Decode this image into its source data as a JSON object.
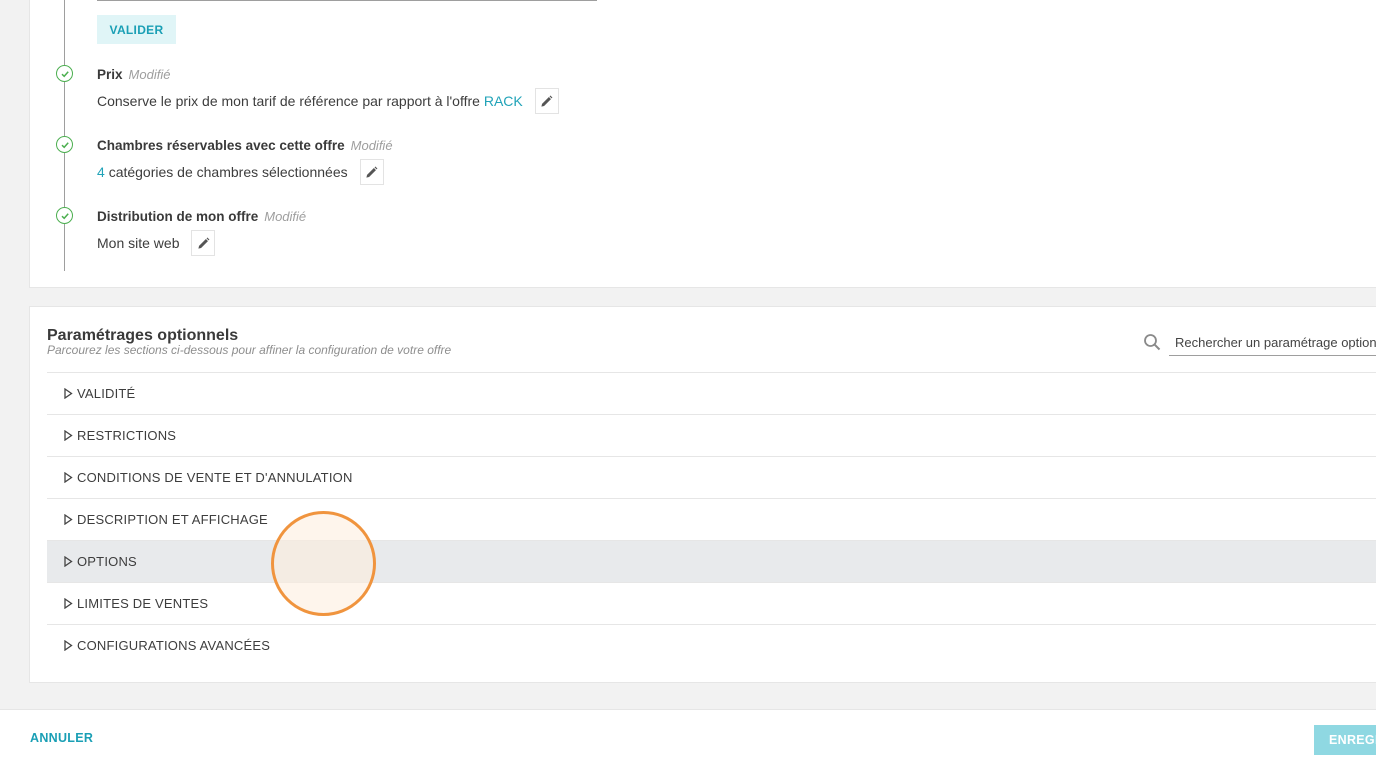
{
  "validate_button": "VALIDER",
  "steps": [
    {
      "title": "Prix",
      "status": "Modifié",
      "text_before": "Conserve le prix de mon tarif de référence par rapport à l'offre",
      "link": "RACK",
      "text_after": ""
    },
    {
      "title": "Chambres réservables avec cette offre",
      "status": "Modifié",
      "text_before": "",
      "link": "4",
      "text_after": "catégories de chambres sélectionnées"
    },
    {
      "title": "Distribution de mon offre",
      "status": "Modifié",
      "text_before": "Mon site web",
      "link": "",
      "text_after": ""
    }
  ],
  "optional": {
    "title": "Paramétrages optionnels",
    "subtitle": "Parcourez les sections ci-dessous pour affiner la configuration de votre offre",
    "search_placeholder": "Rechercher un paramétrage optionnel",
    "sections": [
      "VALIDITÉ",
      "RESTRICTIONS",
      "CONDITIONS DE VENTE ET D'ANNULATION",
      "DESCRIPTION ET AFFICHAGE",
      "OPTIONS",
      "LIMITES DE VENTES",
      "CONFIGURATIONS AVANCÉES"
    ],
    "hovered_section": "OPTIONS"
  },
  "footer": {
    "cancel_label": "ANNULER",
    "save_label": "ENREGISTRER"
  },
  "colors": {
    "accent": "#1a9fb5",
    "success": "#4caf50",
    "cursor": "#f0943e"
  },
  "icons": {
    "step": "check-circle-icon",
    "edit": "pencil-icon",
    "search": "search-icon",
    "section": "triangle-right-icon"
  }
}
